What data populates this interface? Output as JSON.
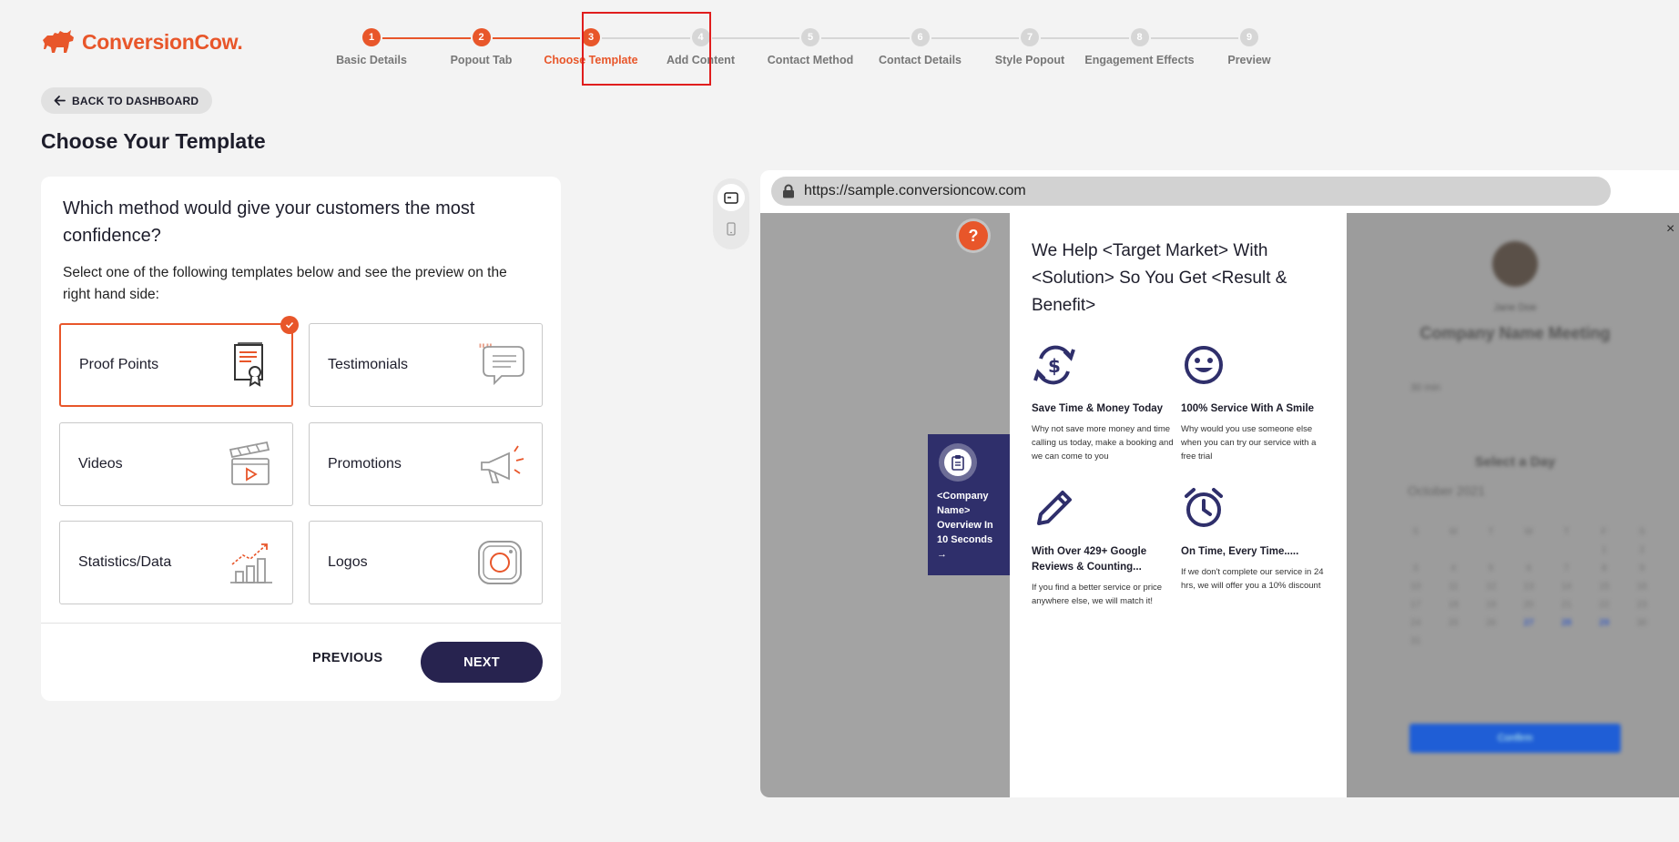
{
  "brand": {
    "name": "ConversionCow.",
    "color": "#e8562a"
  },
  "steps": [
    {
      "num": "1",
      "label": "Basic Details",
      "state": "done"
    },
    {
      "num": "2",
      "label": "Popout Tab",
      "state": "done"
    },
    {
      "num": "3",
      "label": "Choose Template",
      "state": "active"
    },
    {
      "num": "4",
      "label": "Add Content",
      "state": "todo"
    },
    {
      "num": "5",
      "label": "Contact Method",
      "state": "todo"
    },
    {
      "num": "6",
      "label": "Contact Details",
      "state": "todo"
    },
    {
      "num": "7",
      "label": "Style Popout",
      "state": "todo"
    },
    {
      "num": "8",
      "label": "Engagement Effects",
      "state": "todo"
    },
    {
      "num": "9",
      "label": "Preview",
      "state": "todo"
    }
  ],
  "back_button": "BACK TO DASHBOARD",
  "page_title": "Choose Your Template",
  "card": {
    "question": "Which method would give your customers the most confidence?",
    "subtitle": "Select one of the following templates below and see the preview on the right hand side:",
    "templates": [
      {
        "label": "Proof Points",
        "icon": "certificate-icon",
        "selected": true
      },
      {
        "label": "Testimonials",
        "icon": "quote-bubble-icon",
        "selected": false
      },
      {
        "label": "Videos",
        "icon": "clapperboard-icon",
        "selected": false
      },
      {
        "label": "Promotions",
        "icon": "megaphone-icon",
        "selected": false
      },
      {
        "label": "Statistics/Data",
        "icon": "bar-chart-icon",
        "selected": false
      },
      {
        "label": "Logos",
        "icon": "instagram-icon",
        "selected": false
      }
    ],
    "previous_label": "PREVIOUS",
    "next_label": "NEXT"
  },
  "preview": {
    "url": "https://sample.conversioncow.com",
    "help_label": "?",
    "side_tab": "<Company Name> Overview In 10 Seconds →",
    "heading": "We Help <Target Market> With <Solution> So You Get <Result & Benefit>",
    "benefits": [
      {
        "icon": "dollar-cycle-icon",
        "title": "Save Time & Money Today",
        "text": "Why not save more money and time calling us today, make a booking and we can come to you"
      },
      {
        "icon": "smiley-icon",
        "title": "100% Service With A Smile",
        "text": "Why would you use someone else when you can try our service with a free trial"
      },
      {
        "icon": "pencil-icon",
        "title": "With Over 429+ Google Reviews & Counting...",
        "text": "If you find a better service or price anywhere else, we will match it!"
      },
      {
        "icon": "alarm-clock-icon",
        "title": "On Time, Every Time.....",
        "text": "If we don't complete our service in 24 hrs, we will offer you a 10% discount"
      }
    ],
    "calendar": {
      "close": "×",
      "person": "Jane Doe",
      "company": "Company Name Meeting",
      "duration": "30 min",
      "select_day": "Select a Day",
      "month": "October 2021",
      "weekdays": [
        "S",
        "M",
        "T",
        "W",
        "T",
        "F",
        "S"
      ],
      "days": [
        "",
        "",
        "",
        "",
        "",
        "1",
        "2",
        "3",
        "4",
        "5",
        "6",
        "7",
        "8",
        "9",
        "10",
        "11",
        "12",
        "13",
        "14",
        "15",
        "16",
        "17",
        "18",
        "19",
        "20",
        "21",
        "22",
        "23",
        "24",
        "25",
        "26",
        "27",
        "28",
        "29",
        "30",
        "31"
      ],
      "confirm": "Confirm"
    }
  }
}
